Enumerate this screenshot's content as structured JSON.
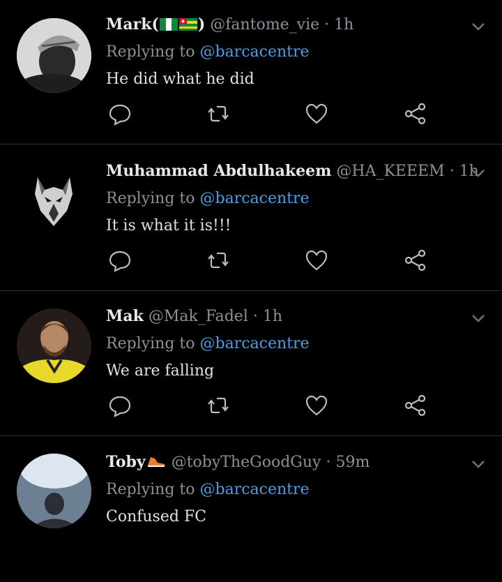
{
  "reply_label": "Replying to",
  "reply_mention": "@barcacentre",
  "colors": {
    "background": "#000000",
    "divider": "#2f3336",
    "muted": "#8b9199",
    "accent": "#4a9ee8"
  },
  "tweets": [
    {
      "name": "Mark(",
      "name_suffix": ")",
      "emoji": [
        "nigeria-flag",
        "togo-flag"
      ],
      "handle": "@fantome_vie",
      "time": "1h",
      "text": "He did what he did"
    },
    {
      "name": "Muhammad Abdulhakeem",
      "handle": "@HA_KEEEM",
      "time": "1h",
      "text": "It is what it is!!!"
    },
    {
      "name": "Mak",
      "handle": "@Mak_Fadel",
      "time": "1h",
      "text": "We are falling"
    },
    {
      "name": "Toby",
      "emoji": [
        "orange-sneaker-emoji"
      ],
      "handle": "@tobyTheGoodGuy",
      "time": "59m",
      "text": "Confused FC"
    }
  ],
  "icons": [
    "reply-icon",
    "retweet-icon",
    "like-icon",
    "share-icon",
    "chevron-down-icon"
  ]
}
